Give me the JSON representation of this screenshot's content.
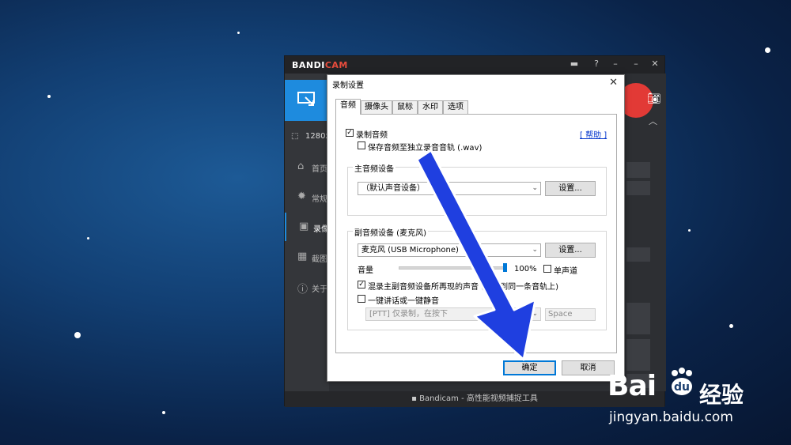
{
  "bandicam": {
    "brand_prefix": "BANDI",
    "brand_suffix": "CAM",
    "size_label": "1280x",
    "side_items": [
      {
        "icon": "home-icon",
        "label": "首页"
      },
      {
        "icon": "gear-icon",
        "label": "常规"
      },
      {
        "icon": "video-settings-icon",
        "label": "录像"
      },
      {
        "icon": "image-icon",
        "label": "截图"
      },
      {
        "icon": "info-icon",
        "label": "关于"
      }
    ],
    "footer": "Bandicam - 高性能视频捕捉工具"
  },
  "dialog": {
    "title": "录制设置",
    "tabs": [
      "音频",
      "摄像头",
      "鼠标",
      "水印",
      "选项"
    ],
    "record_audio_label": "录制音频",
    "record_audio_checked": true,
    "save_separate_label": "保存音频至独立录音音轨 (.wav)",
    "save_separate_checked": false,
    "help_label": "[ 帮助 ]",
    "main_device": {
      "title": "主音频设备",
      "selected": "（默认声音设备）",
      "settings_label": "设置..."
    },
    "sub_device": {
      "title": "副音频设备 (麦克风)",
      "selected": "麦克风 (USB Microphone)",
      "settings_label": "设置...",
      "volume_label": "音量",
      "volume_value": "100%",
      "volume_fraction": 1.0,
      "mono_label": "单声道",
      "mono_checked": false,
      "mix_label": "混录主副音频设备所再现的声音 (录制到同一条音轨上)",
      "mix_checked": true,
      "ptt_label": "一键讲话或一键静音",
      "ptt_checked": false,
      "ptt_mode": "[PTT] 仅录制，在按下",
      "ptt_key": "Space"
    },
    "ok_label": "确定",
    "cancel_label": "取消"
  },
  "watermark": {
    "logo": "Bai",
    "logo_cn": "经验",
    "url": "jingyan.baidu.com"
  },
  "colors": {
    "accent_blue": "#1e8bde",
    "arrow_blue": "#1f3fe0",
    "record_red": "#e23a36"
  }
}
